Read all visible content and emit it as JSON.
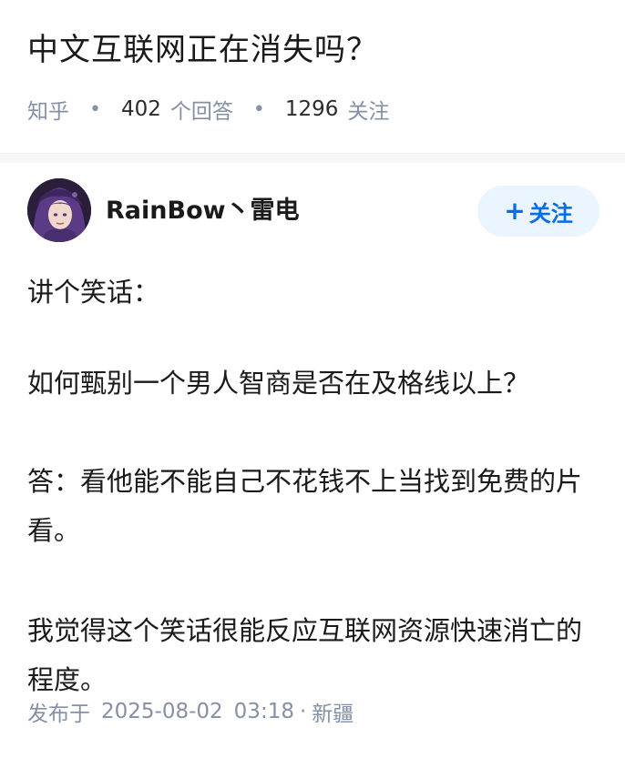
{
  "question": {
    "title": "中文互联网正在消失吗？",
    "source": "知乎",
    "answer_count": "402",
    "answer_unit": "个回答",
    "follower_count": "1296",
    "follower_unit": "关注",
    "separator": "•"
  },
  "author": {
    "name": "RainBow丶雷电",
    "follow_icon": "plus-icon",
    "follow_label": "关注",
    "avatar_colors": {
      "background": "#2a1e3a",
      "hair": "#5b3b86",
      "skin": "#f1d8cf"
    }
  },
  "answer": {
    "paragraphs": [
      "讲个笑话：",
      "如何甄别一个男人智商是否在及格线以上？",
      "答：看他能不能自己不花钱不上当找到免费的片看。",
      "我觉得这个笑话很能反应互联网资源快速消亡的程度。"
    ],
    "published_label": "发布于",
    "date": "2025-08-02",
    "time": "03:18",
    "separator": "·",
    "location": "新疆"
  },
  "colors": {
    "accent": "#056de8",
    "accent_bg": "#ebf5ff",
    "meta_gray": "#8590a6",
    "text": "#1a1a1a"
  }
}
